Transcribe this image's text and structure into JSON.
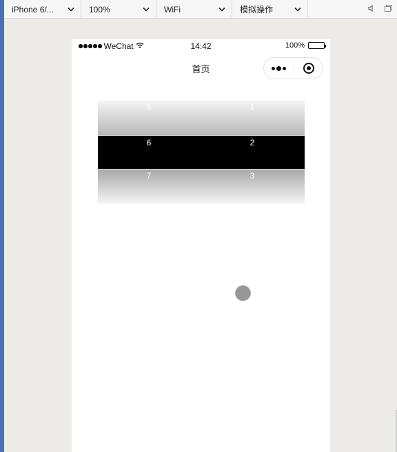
{
  "toolbar": {
    "device_label": "iPhone 6/...",
    "zoom_label": "100%",
    "network_label": "WiFi",
    "operation_label": "模拟操作"
  },
  "status_bar": {
    "carrier": "WeChat",
    "time": "14:42",
    "battery": "100%"
  },
  "nav": {
    "title": "首页"
  },
  "picker": {
    "rows": [
      {
        "col1": "5",
        "col2": "1"
      },
      {
        "col1": "6",
        "col2": "2"
      },
      {
        "col1": "7",
        "col2": "3"
      }
    ]
  },
  "icons": {
    "chevron": "chevron-down-icon",
    "sound": "speaker-icon",
    "window": "window-icon",
    "wifi": "wifi-icon",
    "battery": "battery-icon",
    "more": "more-dots-icon",
    "close": "target-close-icon"
  },
  "colors": {
    "accent_strip": "#4a6fb5",
    "selected_row": "#000000",
    "touch_point": "#969696"
  }
}
